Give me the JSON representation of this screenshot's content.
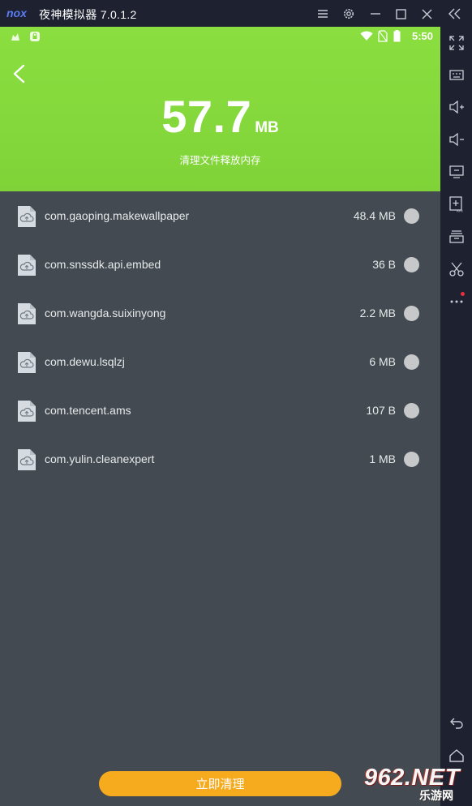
{
  "window": {
    "title": "夜神模拟器 7.0.1.2",
    "logo": "nox"
  },
  "statusbar": {
    "time": "5:50"
  },
  "header": {
    "size_value": "57.7",
    "size_unit": "MB",
    "subtitle": "清理文件释放内存",
    "gradient_top": "#8bde3f",
    "gradient_bottom": "#7fd338"
  },
  "files": [
    {
      "package": "com.gaoping.makewallpaper",
      "size": "48.4 MB"
    },
    {
      "package": "com.snssdk.api.embed",
      "size": "36 B"
    },
    {
      "package": "com.wangda.suixinyong",
      "size": "2.2 MB"
    },
    {
      "package": "com.dewu.lsqlzj",
      "size": "6 MB"
    },
    {
      "package": "com.tencent.ams",
      "size": "107 B"
    },
    {
      "package": "com.yulin.cleanexpert",
      "size": "1 MB"
    }
  ],
  "actions": {
    "clean_label": "立即清理",
    "accent": "#f6ab1f"
  },
  "watermark": {
    "number": "962.NET",
    "text": "乐游网"
  },
  "icons": {
    "title_bar": [
      "menu-icon",
      "settings-icon",
      "minimize-icon",
      "maximize-icon",
      "close-icon",
      "collapse-sidebar-icon"
    ],
    "sidebar": [
      "fullscreen-icon",
      "keyboard-icon",
      "volume-up-icon",
      "volume-down-icon",
      "screen-icon",
      "apk-install-icon",
      "multi-instance-icon",
      "scissors-icon",
      "more-icon",
      "back-nav-icon",
      "home-nav-icon"
    ]
  }
}
